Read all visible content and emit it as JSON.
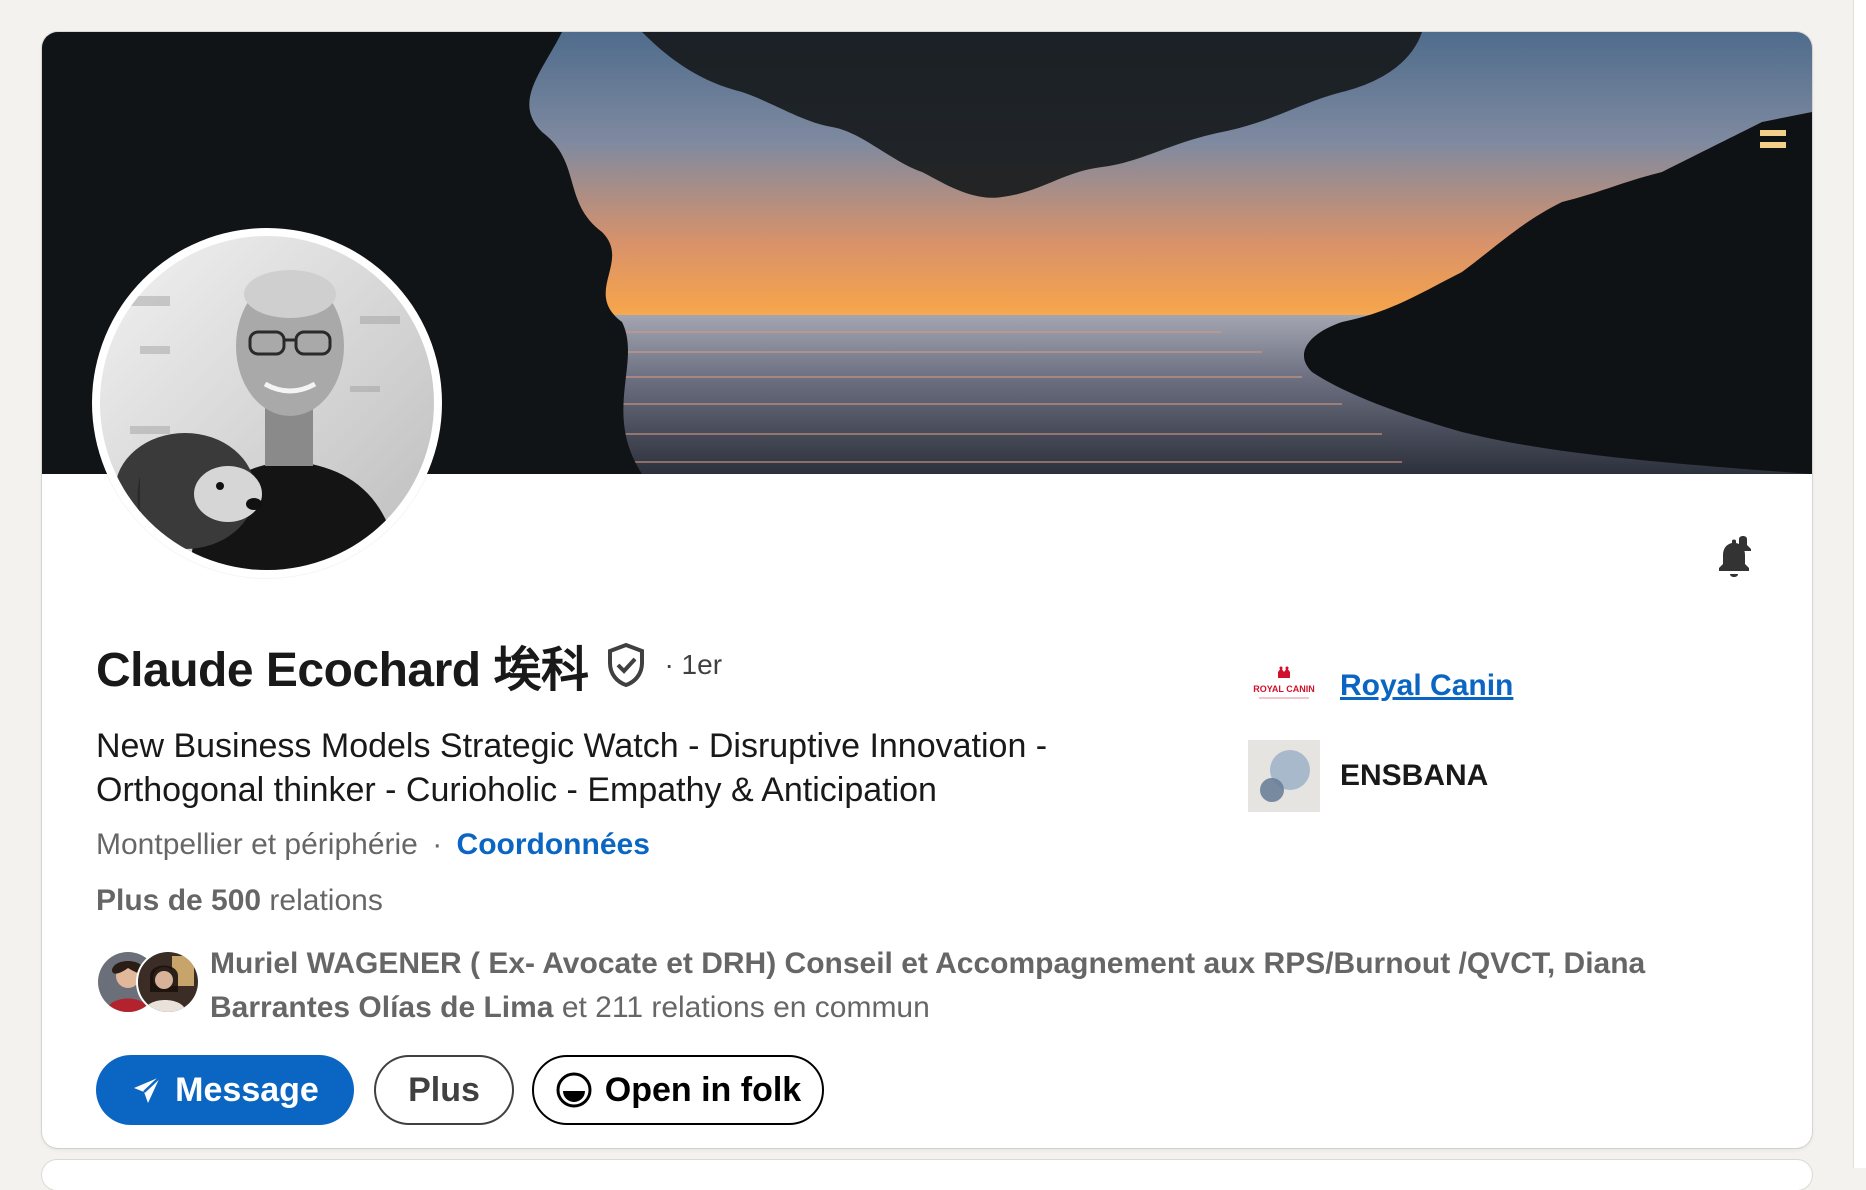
{
  "profile": {
    "name": "Claude Ecochard 埃科",
    "degree": "· 1er",
    "headline": "New Business Models Strategic Watch - Disruptive Innovation - Orthogonal thinker - Curioholic - Empathy & Anticipation",
    "location": "Montpellier et périphérie",
    "separator": "·",
    "contact_info_label": "Coordonnées",
    "connections_bold": "Plus de 500",
    "connections_suffix": " relations",
    "mutual_names": "Muriel WAGENER ( Ex- Avocate et DRH) Conseil et Accompagnement aux RPS/Burnout /QVCT, Diana Barrantes Olías de Lima",
    "mutual_suffix": " et 211 relations en commun"
  },
  "companies": [
    {
      "name": "Royal Canin",
      "logo_text": "ROYAL CANIN",
      "icon": "royal-canin-logo"
    },
    {
      "name": "ENSBANA",
      "icon": "ensbana-logo"
    }
  ],
  "actions": {
    "message_label": "Message",
    "more_label": "Plus",
    "folk_label": "Open in folk"
  },
  "colors": {
    "brand_blue": "#0a66c2",
    "page_background": "#f4f2ee",
    "card_background": "#ffffff"
  },
  "icons": {
    "verified": "shield-check-icon",
    "bell": "bell-icon",
    "message": "send-icon",
    "folk": "folk-icon"
  }
}
